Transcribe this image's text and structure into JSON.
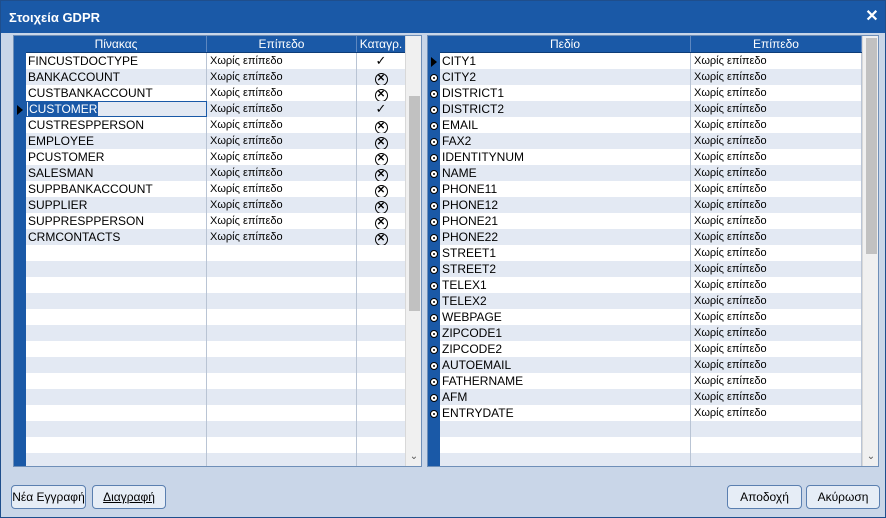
{
  "window": {
    "title": "Στοιχεία GDPR",
    "close_icon": "close-icon"
  },
  "left_table": {
    "columns": [
      "Πίνακας",
      "Επίπεδο",
      "Καταγρ."
    ],
    "selected_index": 3,
    "rows": [
      {
        "name": "FINCUSTDOCTYPE",
        "level": "Χωρίς επίπεδο",
        "log": "check"
      },
      {
        "name": "BANKACCOUNT",
        "level": "Χωρίς επίπεδο",
        "log": "x"
      },
      {
        "name": "CUSTBANKACCOUNT",
        "level": "Χωρίς επίπεδο",
        "log": "x"
      },
      {
        "name": "CUSTOMER",
        "level": "Χωρίς επίπεδο",
        "log": "check"
      },
      {
        "name": "CUSTRESPPERSON",
        "level": "Χωρίς επίπεδο",
        "log": "x"
      },
      {
        "name": "EMPLOYEE",
        "level": "Χωρίς επίπεδο",
        "log": "x"
      },
      {
        "name": "PCUSTOMER",
        "level": "Χωρίς επίπεδο",
        "log": "x"
      },
      {
        "name": "SALESMAN",
        "level": "Χωρίς επίπεδο",
        "log": "x"
      },
      {
        "name": "SUPPBANKACCOUNT",
        "level": "Χωρίς επίπεδο",
        "log": "x"
      },
      {
        "name": "SUPPLIER",
        "level": "Χωρίς επίπεδο",
        "log": "x"
      },
      {
        "name": "SUPPRESPPERSON",
        "level": "Χωρίς επίπεδο",
        "log": "x"
      },
      {
        "name": "CRMCONTACTS",
        "level": "Χωρίς επίπεδο",
        "log": "x"
      }
    ]
  },
  "right_table": {
    "columns": [
      "Πεδίο",
      "Επίπεδο"
    ],
    "current_index": 0,
    "rows": [
      {
        "field": "CITY1",
        "level": "Χωρίς επίπεδο"
      },
      {
        "field": "CITY2",
        "level": "Χωρίς επίπεδο"
      },
      {
        "field": "DISTRICT1",
        "level": "Χωρίς επίπεδο"
      },
      {
        "field": "DISTRICT2",
        "level": "Χωρίς επίπεδο"
      },
      {
        "field": "EMAIL",
        "level": "Χωρίς επίπεδο"
      },
      {
        "field": "FAX2",
        "level": "Χωρίς επίπεδο"
      },
      {
        "field": "IDENTITYNUM",
        "level": "Χωρίς επίπεδο"
      },
      {
        "field": "NAME",
        "level": "Χωρίς επίπεδο"
      },
      {
        "field": "PHONE11",
        "level": "Χωρίς επίπεδο"
      },
      {
        "field": "PHONE12",
        "level": "Χωρίς επίπεδο"
      },
      {
        "field": "PHONE21",
        "level": "Χωρίς επίπεδο"
      },
      {
        "field": "PHONE22",
        "level": "Χωρίς επίπεδο"
      },
      {
        "field": "STREET1",
        "level": "Χωρίς επίπεδο"
      },
      {
        "field": "STREET2",
        "level": "Χωρίς επίπεδο"
      },
      {
        "field": "TELEX1",
        "level": "Χωρίς επίπεδο"
      },
      {
        "field": "TELEX2",
        "level": "Χωρίς επίπεδο"
      },
      {
        "field": "WEBPAGE",
        "level": "Χωρίς επίπεδο"
      },
      {
        "field": "ZIPCODE1",
        "level": "Χωρίς επίπεδο"
      },
      {
        "field": "ZIPCODE2",
        "level": "Χωρίς επίπεδο"
      },
      {
        "field": "AUTOEMAIL",
        "level": "Χωρίς επίπεδο"
      },
      {
        "field": "FATHERNAME",
        "level": "Χωρίς επίπεδο"
      },
      {
        "field": "AFM",
        "level": "Χωρίς επίπεδο"
      },
      {
        "field": "ENTRYDATE",
        "level": "Χωρίς επίπεδο"
      }
    ]
  },
  "buttons": {
    "new": "Νέα Εγγραφή",
    "delete": "Διαγραφή",
    "accept": "Αποδοχή",
    "cancel": "Ακύρωση"
  },
  "colors": {
    "title_bar": "#1a59a7",
    "header": "#1a59a7",
    "alt_row": "#e3e9f3",
    "background": "#c9d6e8"
  }
}
